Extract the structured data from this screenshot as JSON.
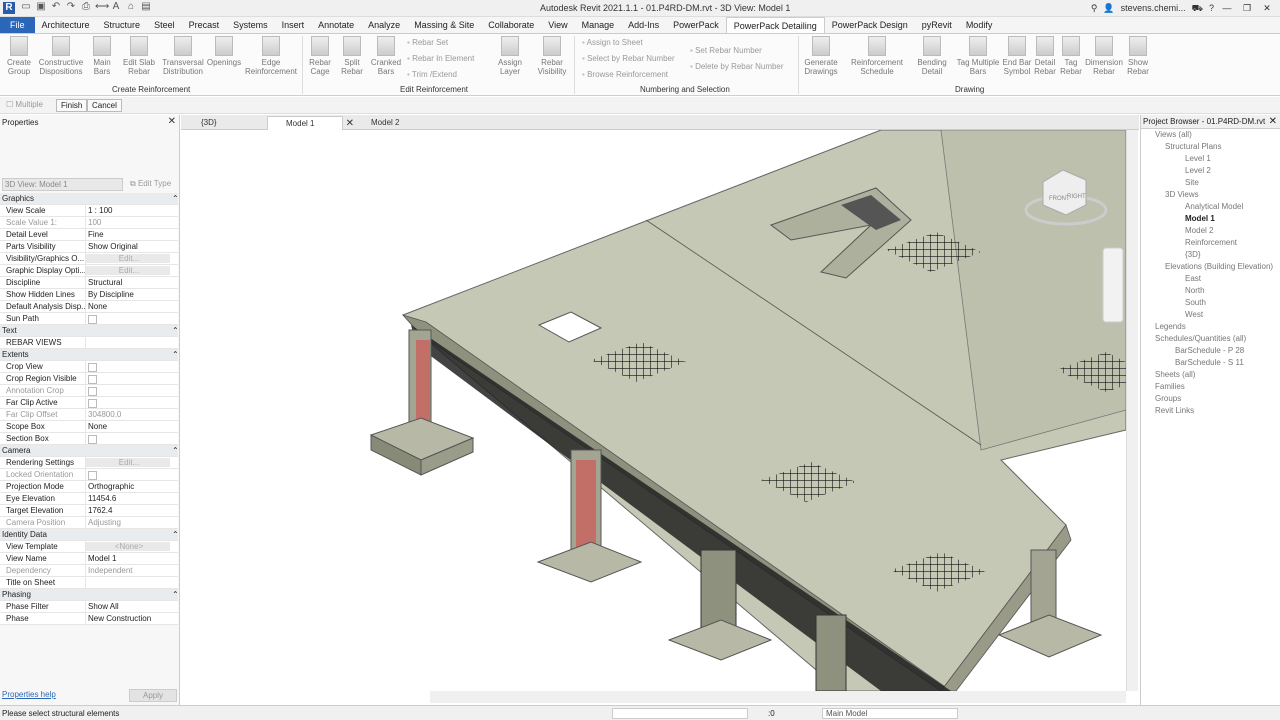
{
  "app": {
    "title": "Autodesk Revit 2021.1.1 - 01.P4RD-DM.rvt - 3D View: Model 1",
    "user": "stevens.chemi...",
    "logo": "R"
  },
  "ribbon_tabs": [
    "File",
    "Architecture",
    "Structure",
    "Steel",
    "Precast",
    "Systems",
    "Insert",
    "Annotate",
    "Analyze",
    "Massing & Site",
    "Collaborate",
    "View",
    "Manage",
    "Add-Ins",
    "PowerPack",
    "PowerPack Detailing",
    "PowerPack Design",
    "pyRevit",
    "Modify"
  ],
  "ribbon": {
    "create": [
      "Create Group",
      "Constructive Dispositions",
      "Main Bars",
      "Edit Slab Rebar",
      "Transversal Distribution",
      "Openings",
      "Edge Reinforcement"
    ],
    "create_panel": "Create Reinforcement",
    "edit": [
      "Rebar Cage",
      "Split Rebar",
      "Cranked Bars"
    ],
    "edit_small": [
      "Rebar Set",
      "Rebar In Element",
      "Trim /Extend"
    ],
    "edit_extra": [
      "Assign Layer",
      "Rebar Visibility"
    ],
    "edit_panel": "Edit Reinforcement",
    "numbering_small": [
      "Assign to Sheet",
      "Select by Rebar Number",
      "Browse Reinforcement",
      "Set Rebar Number",
      "Delete by Rebar Number"
    ],
    "numbering_panel": "Numbering and Selection",
    "drawing": [
      "Generate Drawings",
      "Reinforcement Schedule",
      "Bending Detail",
      "Tag Multiple Bars",
      "End Bar Symbol",
      "Detail Rebar",
      "Tag Rebar",
      "Dimension Rebar",
      "Show Rebar"
    ],
    "drawing_panel": "Drawing"
  },
  "options_bar": {
    "multiple": "Multiple",
    "finish": "Finish",
    "cancel": "Cancel"
  },
  "properties": {
    "title": "Properties",
    "type": "3D View: Model 1",
    "edit_type": "Edit Type",
    "help": "Properties help",
    "apply": "Apply",
    "rows": [
      {
        "k": "Graphics",
        "sec": true
      },
      {
        "k": "View Scale",
        "v": "1 : 100"
      },
      {
        "k": "Scale Value    1:",
        "v": "100",
        "grey": true
      },
      {
        "k": "Detail Level",
        "v": "Fine"
      },
      {
        "k": "Parts Visibility",
        "v": "Show Original"
      },
      {
        "k": "Visibility/Graphics O...",
        "v": "Edit...",
        "btn": true
      },
      {
        "k": "Graphic Display Opti...",
        "v": "Edit...",
        "btn": true
      },
      {
        "k": "Discipline",
        "v": "Structural"
      },
      {
        "k": "Show Hidden Lines",
        "v": "By Discipline"
      },
      {
        "k": "Default Analysis Disp...",
        "v": "None"
      },
      {
        "k": "Sun Path",
        "cb": true
      },
      {
        "k": "Text",
        "sec": true
      },
      {
        "k": "REBAR VIEWS",
        "v": ""
      },
      {
        "k": "Extents",
        "sec": true
      },
      {
        "k": "Crop View",
        "cb": true
      },
      {
        "k": "Crop Region Visible",
        "cb": true
      },
      {
        "k": "Annotation Crop",
        "cb": true,
        "grey": true
      },
      {
        "k": "Far Clip Active",
        "cb": true
      },
      {
        "k": "Far Clip Offset",
        "v": "304800.0",
        "grey": true
      },
      {
        "k": "Scope Box",
        "v": "None"
      },
      {
        "k": "Section Box",
        "cb": true
      },
      {
        "k": "Camera",
        "sec": true
      },
      {
        "k": "Rendering Settings",
        "v": "Edit...",
        "btn": true
      },
      {
        "k": "Locked Orientation",
        "cb": true,
        "grey": true
      },
      {
        "k": "Projection Mode",
        "v": "Orthographic"
      },
      {
        "k": "Eye Elevation",
        "v": "11454.6"
      },
      {
        "k": "Target Elevation",
        "v": "1762.4"
      },
      {
        "k": "Camera Position",
        "v": "Adjusting",
        "grey": true
      },
      {
        "k": "Identity Data",
        "sec": true
      },
      {
        "k": "View Template",
        "v": "<None>",
        "btn": true
      },
      {
        "k": "View Name",
        "v": "Model 1"
      },
      {
        "k": "Dependency",
        "v": "Independent",
        "grey": true
      },
      {
        "k": "Title on Sheet",
        "v": ""
      },
      {
        "k": "Phasing",
        "sec": true
      },
      {
        "k": "Phase Filter",
        "v": "Show All"
      },
      {
        "k": "Phase",
        "v": "New Construction"
      }
    ]
  },
  "view_tabs": [
    "{3D}",
    "Model 1",
    "Model 2"
  ],
  "viewcube": {
    "front": "FRONT",
    "right": "RIGHT"
  },
  "browser": {
    "title": "Project Browser - 01.P4RD-DM.rvt",
    "items": [
      {
        "t": "Views (all)",
        "l": 1
      },
      {
        "t": "Structural Plans",
        "l": 2
      },
      {
        "t": "Level 1",
        "l": 4
      },
      {
        "t": "Level 2",
        "l": 4
      },
      {
        "t": "Site",
        "l": 4
      },
      {
        "t": "3D Views",
        "l": 2
      },
      {
        "t": "Analytical Model",
        "l": 4
      },
      {
        "t": "Model 1",
        "l": 4,
        "b": true
      },
      {
        "t": "Model 2",
        "l": 4
      },
      {
        "t": "Reinforcement",
        "l": 4
      },
      {
        "t": "{3D}",
        "l": 4
      },
      {
        "t": "Elevations (Building Elevation)",
        "l": 2
      },
      {
        "t": "East",
        "l": 4
      },
      {
        "t": "North",
        "l": 4
      },
      {
        "t": "South",
        "l": 4
      },
      {
        "t": "West",
        "l": 4
      },
      {
        "t": "Legends",
        "l": 1
      },
      {
        "t": "Schedules/Quantities (all)",
        "l": 1
      },
      {
        "t": "BarSchedule - P 28",
        "l": 3
      },
      {
        "t": "BarSchedule - S 11",
        "l": 3
      },
      {
        "t": "Sheets (all)",
        "l": 1
      },
      {
        "t": "Families",
        "l": 1
      },
      {
        "t": "Groups",
        "l": 1
      },
      {
        "t": "Revit Links",
        "l": 1
      }
    ]
  },
  "status": {
    "message": "Please select structural elements",
    "zero": ":0",
    "model": "Main Model"
  }
}
